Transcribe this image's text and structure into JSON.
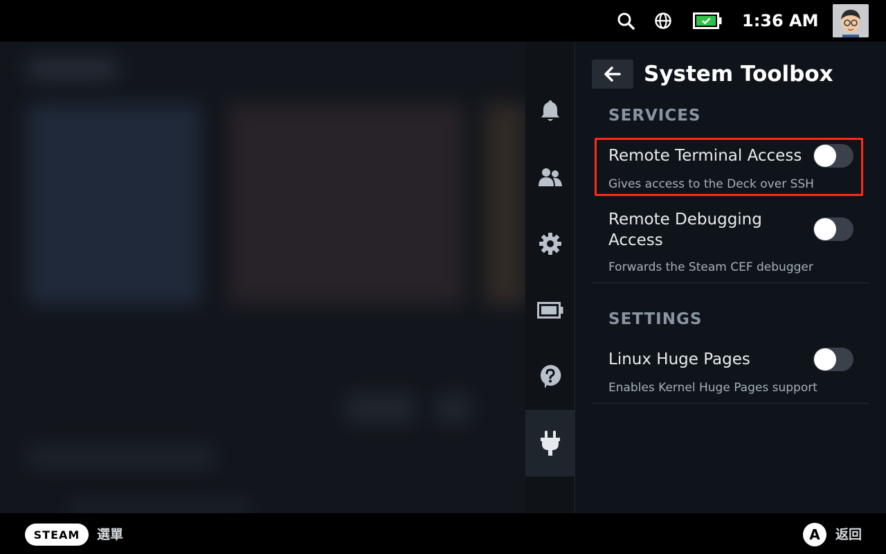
{
  "status_bar": {
    "time": "1:36 AM",
    "icons": [
      "search-icon",
      "globe-icon",
      "battery-icon",
      "avatar"
    ],
    "battery_color": "#2fc24a"
  },
  "sidebar": {
    "tabs": [
      {
        "icon": "bell-icon",
        "active": false
      },
      {
        "icon": "friends-icon",
        "active": false
      },
      {
        "icon": "gear-icon",
        "active": false
      },
      {
        "icon": "battery-icon",
        "active": false
      },
      {
        "icon": "help-icon",
        "active": false
      },
      {
        "icon": "plug-icon",
        "active": true
      }
    ]
  },
  "panel": {
    "title": "System Toolbox",
    "sections": [
      {
        "heading": "SERVICES",
        "items": [
          {
            "label": "Remote Terminal Access",
            "description": "Gives access to the Deck over SSH",
            "enabled": false,
            "highlighted": true
          },
          {
            "label_line1": "Remote Debugging",
            "label_line2": "Access",
            "description": "Forwards the Steam CEF debugger",
            "enabled": false
          }
        ]
      },
      {
        "heading": "SETTINGS",
        "items": [
          {
            "label": "Linux Huge Pages",
            "description": "Enables Kernel Huge Pages support",
            "enabled": false
          }
        ]
      }
    ],
    "highlight_color": "#ff2b18"
  },
  "bottom_bar": {
    "steam_label": "STEAM",
    "menu_label": "選單",
    "a_label": "A",
    "back_label": "返回"
  }
}
